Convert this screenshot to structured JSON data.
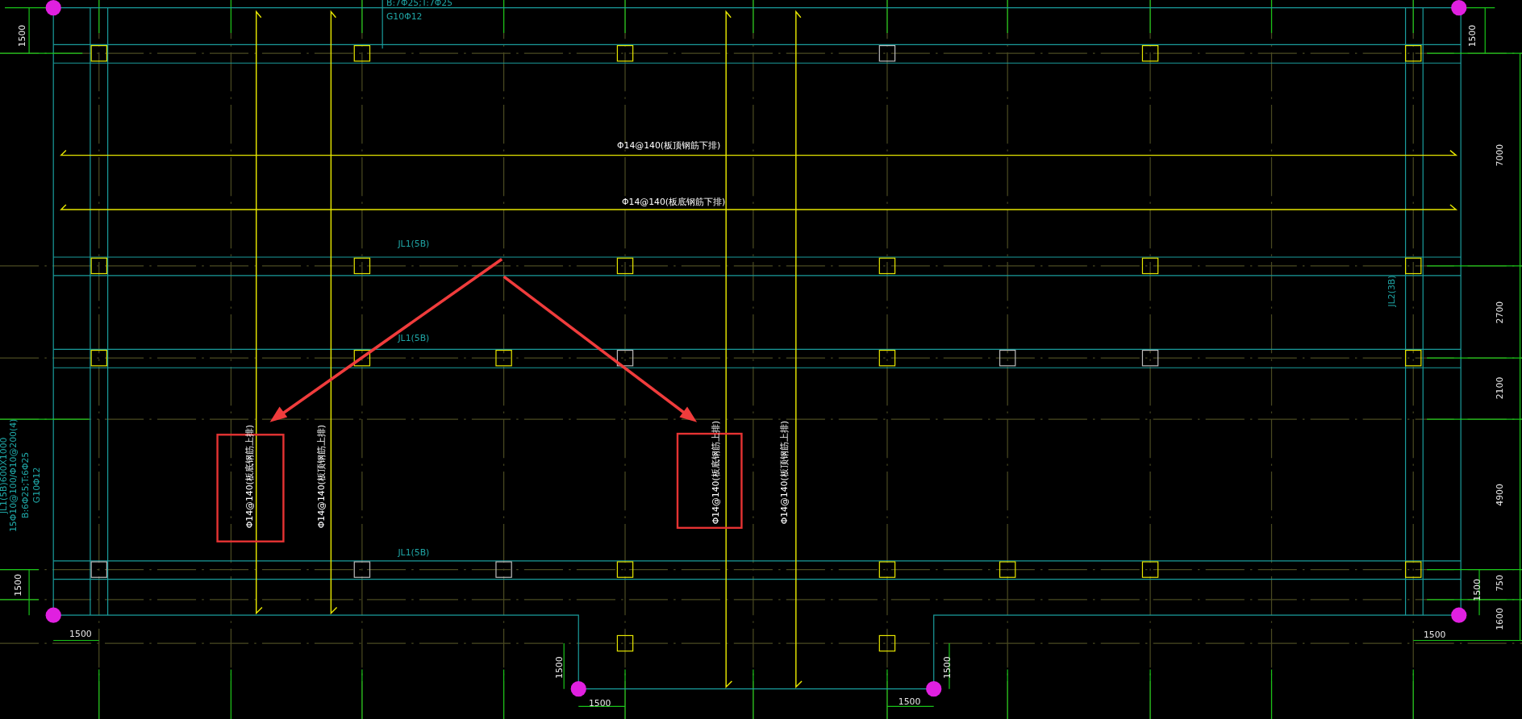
{
  "top_labels": [
    "B:7Φ25;T:7Φ25",
    "G10Φ12"
  ],
  "horizontal_rebar_labels": [
    "Φ14@140(板顶钢筋下排)",
    "Φ14@140(板底钢筋下排)"
  ],
  "vertical_rebar_labels": [
    "Φ14@140(板底钢筋上排)",
    "Φ14@140(板顶钢筋上排)",
    "Φ14@140(板底钢筋上排)",
    "Φ14@140(板顶钢筋上排)"
  ],
  "beam_labels": [
    "JL1(5B)",
    "JL1(5B)",
    "JL1(5B)",
    "JL2(3B)"
  ],
  "left_beam_note": [
    "JL1(5B)600X1000",
    "15Φ10@100/Φ10@200(4)",
    "B:6Φ25;T:6Φ25",
    "G10Φ12"
  ],
  "right_dimensions": [
    "1500",
    "7000",
    "2700",
    "2100",
    "4900",
    "750",
    "1500",
    "1600",
    "1500"
  ],
  "left_dimensions": [
    "1500",
    "1500",
    "1500"
  ],
  "bottom_dimensions": [
    "1500",
    "1500",
    "1500",
    "1500"
  ]
}
